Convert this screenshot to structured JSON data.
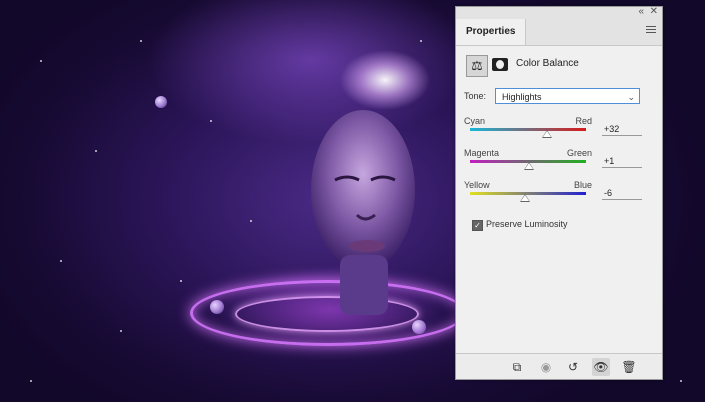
{
  "panel": {
    "tab_label": "Properties",
    "adjustment_title": "Color Balance",
    "tone": {
      "label": "Tone:",
      "selected": "Highlights"
    },
    "sliders": [
      {
        "left": "Cyan",
        "right": "Red",
        "value": "+32",
        "position": 0.66,
        "gradient": [
          "#19b8d8",
          "#d81a1a"
        ]
      },
      {
        "left": "Magenta",
        "right": "Green",
        "value": "+1",
        "position": 0.505,
        "gradient": [
          "#c020c0",
          "#20b020"
        ]
      },
      {
        "left": "Yellow",
        "right": "Blue",
        "value": "-6",
        "position": 0.47,
        "gradient": [
          "#e0e020",
          "#2020d0"
        ]
      }
    ],
    "preserve_luminosity": {
      "label": "Preserve Luminosity",
      "checked": true
    }
  },
  "icons": {
    "collapse": "collapse-icon",
    "close": "close-icon",
    "menu": "panel-menu-icon",
    "balance": "color-balance-icon",
    "mask": "layer-mask-icon",
    "clip": "clip-to-layer-icon",
    "view_previous": "view-previous-icon",
    "reset": "reset-icon",
    "visibility": "visibility-icon",
    "delete": "trash-icon"
  },
  "colors": {
    "panel_bg": "#f0f0f0",
    "select_border": "#4f8fd6"
  }
}
